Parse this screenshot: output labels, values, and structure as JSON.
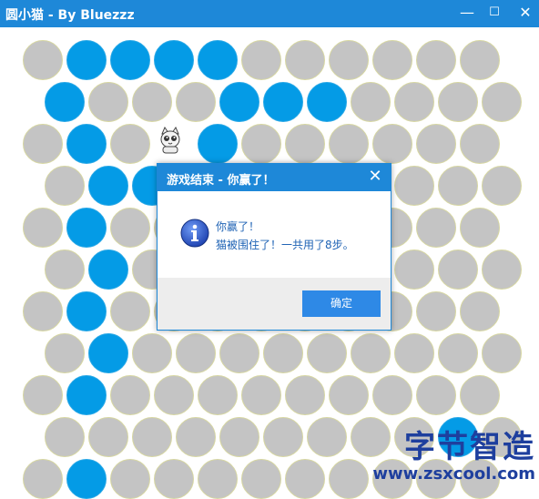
{
  "window": {
    "title": "圆小猫  - By Bluezzz",
    "minimize": "—",
    "maximize": "☐",
    "close": "✕",
    "accent_color": "#1e88d8"
  },
  "board": {
    "rows": [
      "gbbbbgggggg",
      "bgggbbbgggg",
      "gbgCbgggggg",
      "gbbgggggggg",
      "gbggggggggg",
      "gbggggggggg",
      "gbggggggggg",
      "gbggggggggg",
      "gbggggggggg",
      "gggggggggbg",
      "gbggggggggg"
    ],
    "legend": {
      "g": "empty",
      "b": "blocked",
      "C": "cat"
    },
    "colors": {
      "empty": "#c4c4c4",
      "blocked": "#049be6"
    }
  },
  "dialog": {
    "title": "游戏结束 - 你赢了！",
    "close": "✕",
    "icon": "info-icon",
    "line1": "你赢了！",
    "line2": "猫被围住了！一共用了8步。",
    "ok_label": "确定"
  },
  "watermark": {
    "text": "字节智造",
    "url": "www.zsxcool.com"
  }
}
